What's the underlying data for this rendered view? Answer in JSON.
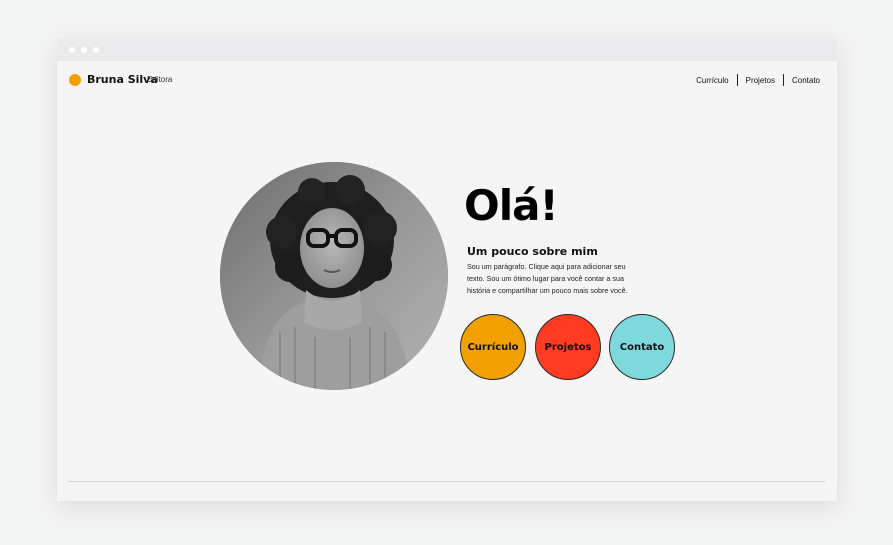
{
  "header": {
    "brand_name": "Bruna Silva",
    "brand_subtitle": "Editora",
    "nav": [
      "Currículo",
      "Projetos",
      "Contato"
    ]
  },
  "hero": {
    "greeting": "Olá!",
    "about_title": "Um pouco sobre mim",
    "about_lines": [
      "Sou um parágrafo. Clique aqui para adicionar seu",
      "texto. Sou um ótimo lugar para você contar a sua",
      "história e compartilhar um pouco mais sobre você."
    ],
    "photo_icon": "portrait-photo",
    "buttons": [
      {
        "label": "Currículo",
        "color": "#f2a000"
      },
      {
        "label": "Projetos",
        "color": "#ff3b21"
      },
      {
        "label": "Contato",
        "color": "#7ed9dc"
      }
    ]
  },
  "colors": {
    "accent": "#f2a000",
    "background": "#f5f5f5"
  }
}
